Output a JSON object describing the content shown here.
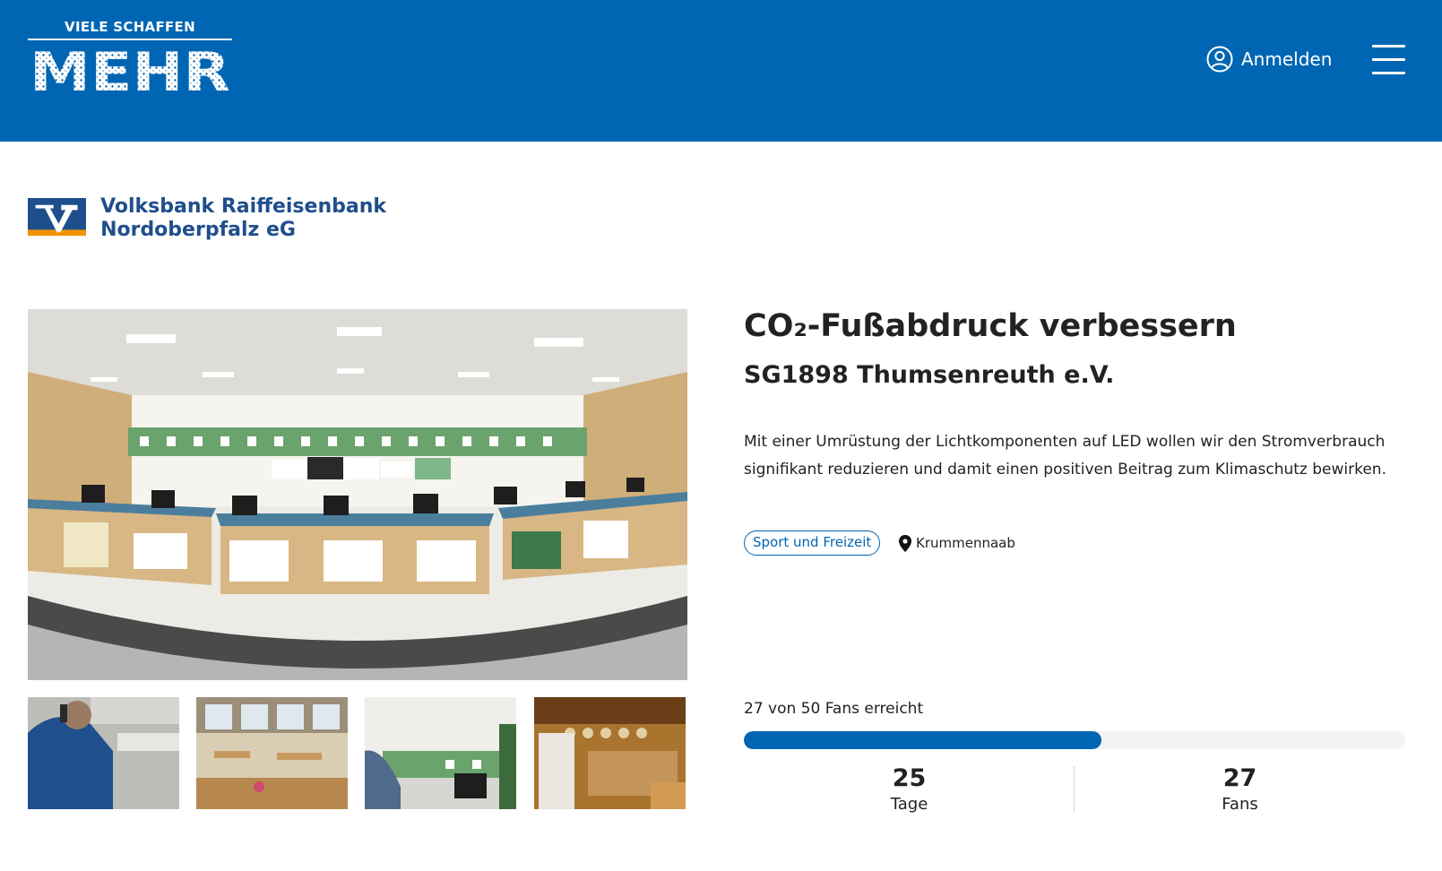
{
  "header": {
    "logo_top": "VIELE SCHAFFEN",
    "logo_main": "MEHR",
    "login_label": "Anmelden",
    "login_icon": "user-circle-icon",
    "menu_icon": "hamburger-menu-icon",
    "background_color": "#0066b3"
  },
  "bank": {
    "name_line1": "Volksbank Raiffeisenbank",
    "name_line2": "Nordoberpfalz eG",
    "logo_icon": "volksbank-logo-icon",
    "brand_blue": "#1f4e8c",
    "brand_orange": "#f39200"
  },
  "gallery": {
    "hero_alt": "shooting-range-hall-panorama",
    "thumbnails": [
      "shooter-thumbnail",
      "clubhouse-dining-thumbnail",
      "range-targets-thumbnail",
      "clubhouse-bar-thumbnail"
    ]
  },
  "project": {
    "title": "CO₂-Fußabdruck verbessern",
    "organization": "SG1898 Thumsenreuth e.V.",
    "description": "Mit einer Umrüstung der Lichtkomponenten auf LED wollen wir den Stromverbrauch signifikant reduzieren und damit einen positiven Beitrag zum Klimaschutz bewirken.",
    "category": "Sport und Freizeit",
    "location": "Krummennaab",
    "location_icon": "map-pin-icon",
    "accent_color": "#0066b3"
  },
  "progress": {
    "text": "27 von 50 Fans erreicht",
    "current": 27,
    "goal": 50,
    "fraction": 0.54
  },
  "stats": {
    "days_value": "25",
    "days_label": "Tage",
    "fans_value": "27",
    "fans_label": "Fans"
  }
}
